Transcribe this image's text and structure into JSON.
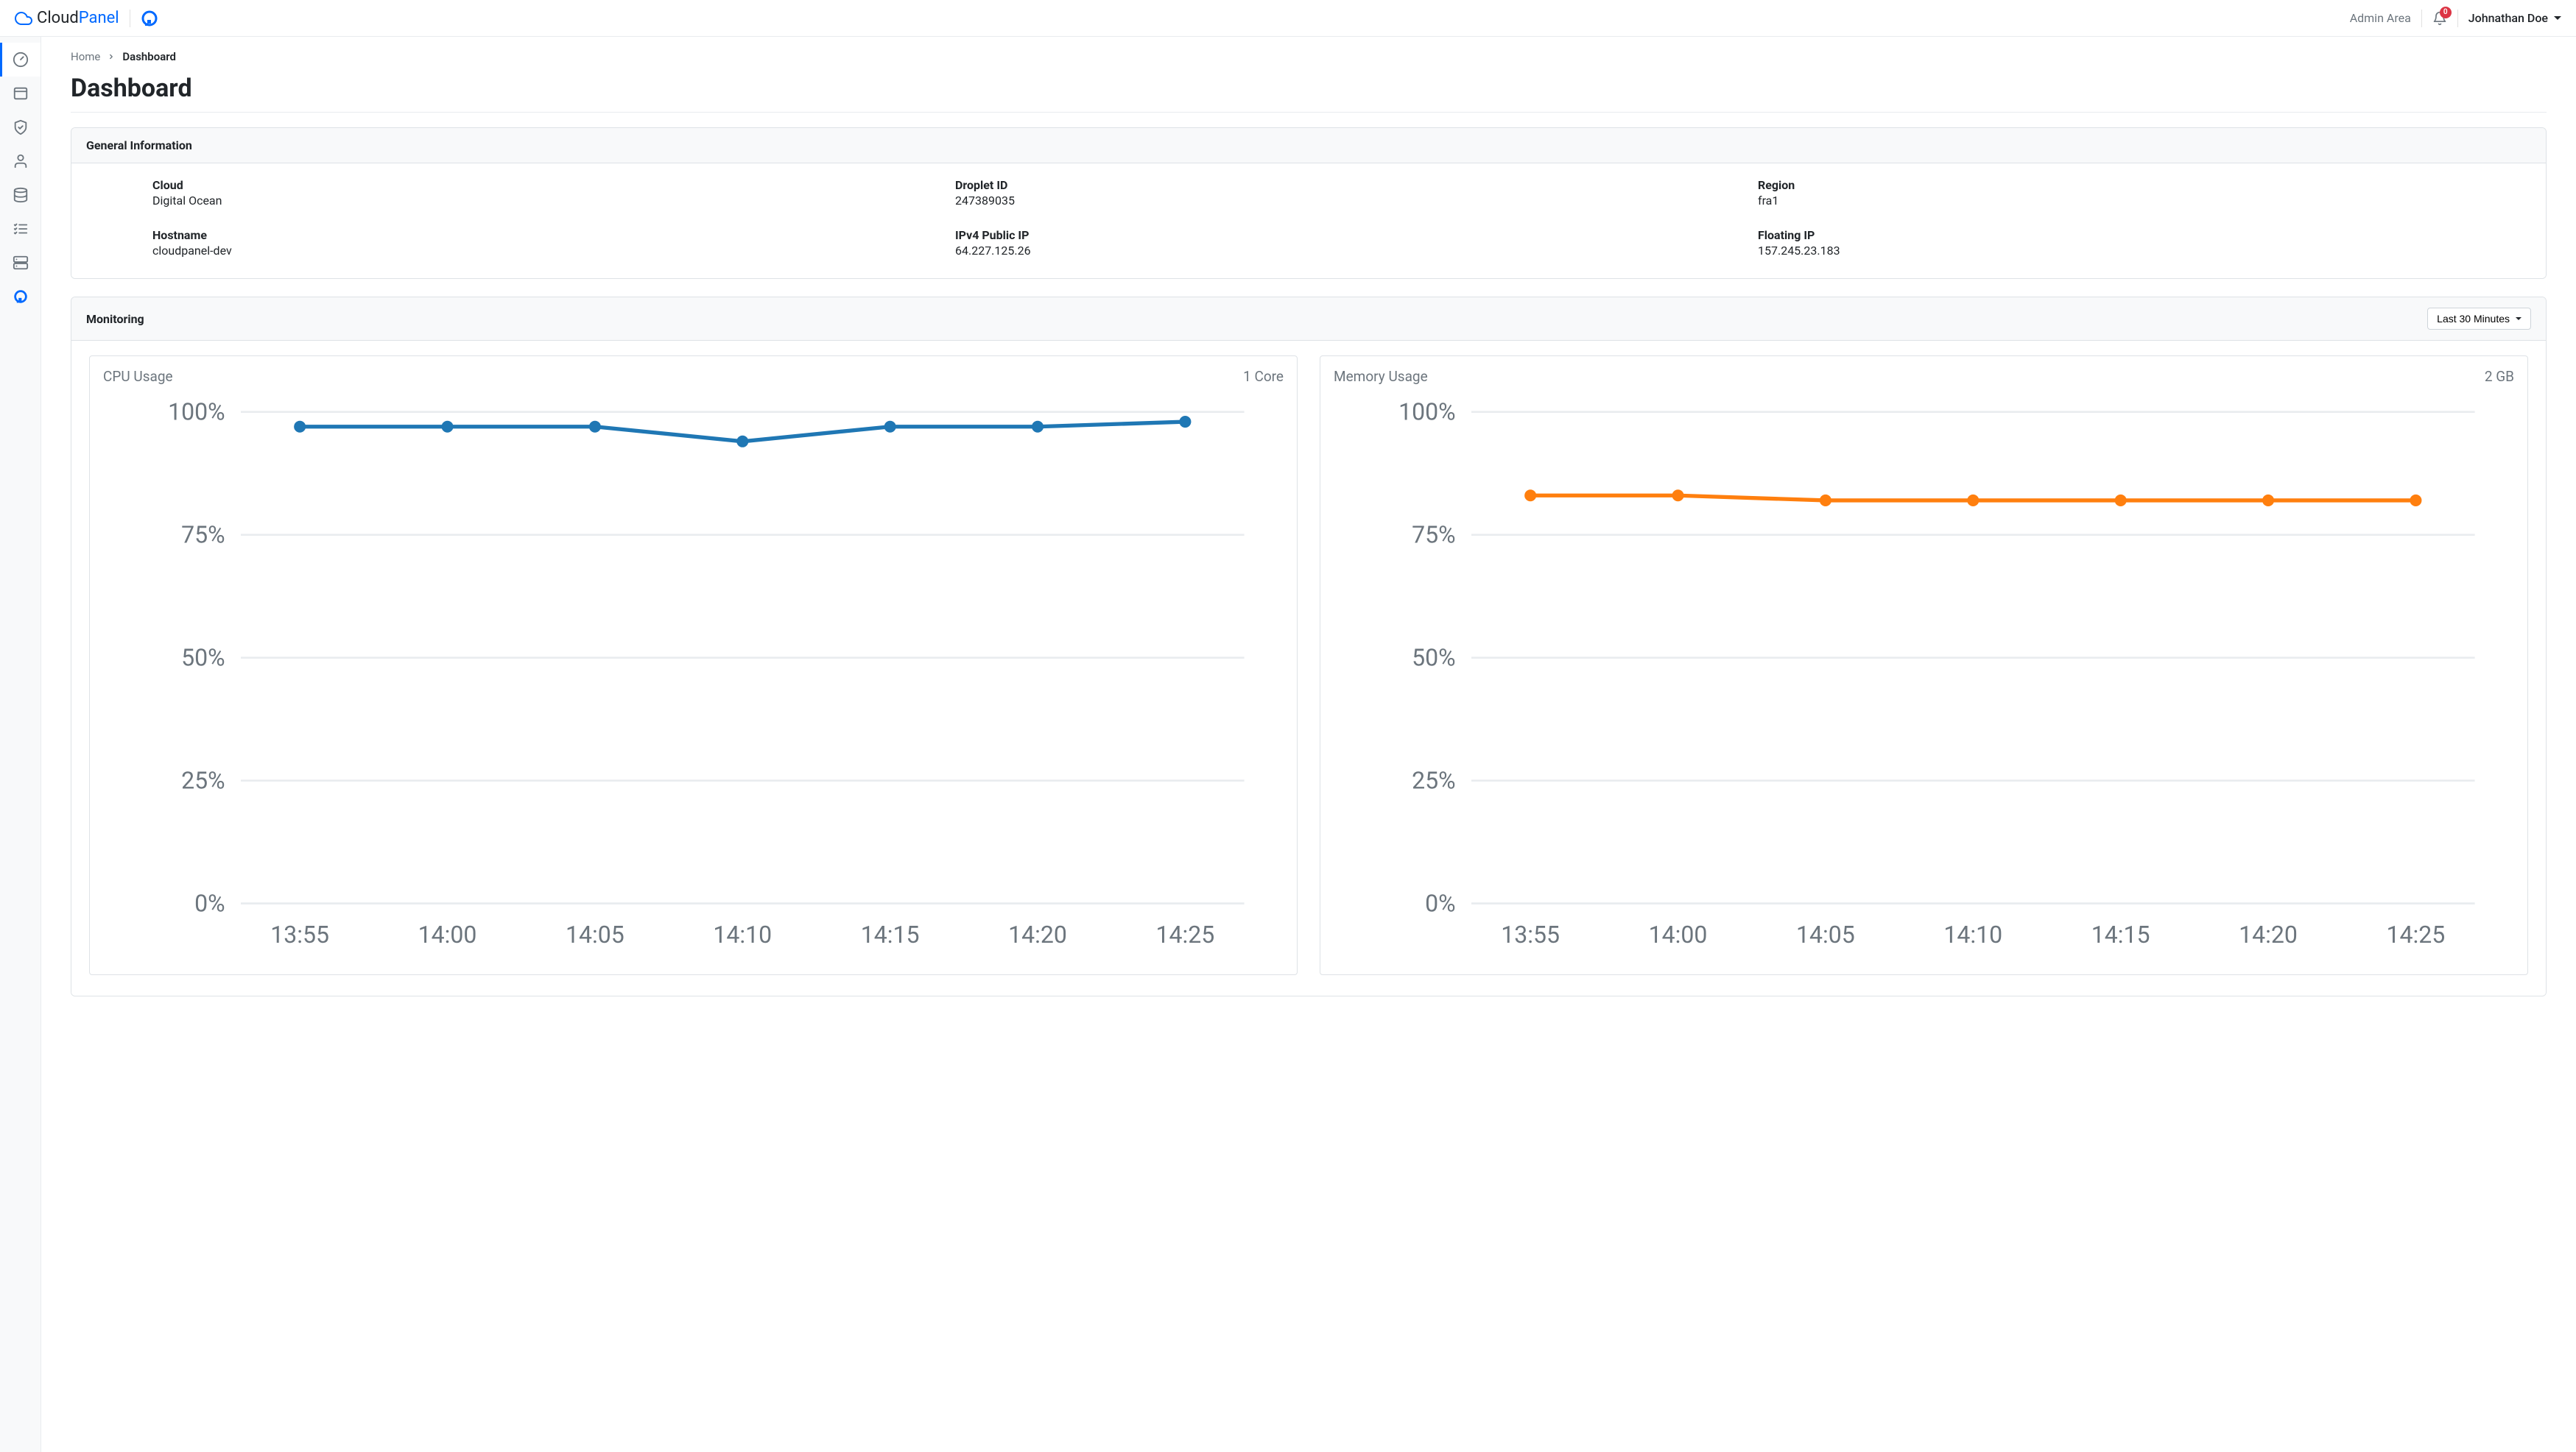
{
  "brand": {
    "part1": "Cloud",
    "part2": "Panel"
  },
  "header": {
    "admin_area": "Admin Area",
    "notifications_count": "0",
    "user_name": "Johnathan Doe"
  },
  "breadcrumb": {
    "home": "Home",
    "current": "Dashboard"
  },
  "page_title": "Dashboard",
  "general_info": {
    "title": "General Information",
    "items": [
      {
        "label": "Cloud",
        "value": "Digital Ocean"
      },
      {
        "label": "Droplet ID",
        "value": "247389035"
      },
      {
        "label": "Region",
        "value": "fra1"
      },
      {
        "label": "Hostname",
        "value": "cloudpanel-dev"
      },
      {
        "label": "IPv4 Public IP",
        "value": "64.227.125.26"
      },
      {
        "label": "Floating IP",
        "value": "157.245.23.183"
      }
    ]
  },
  "monitoring": {
    "title": "Monitoring",
    "range_selected": "Last 30 Minutes",
    "charts": {
      "cpu": {
        "title": "CPU Usage",
        "subtitle": "1 Core"
      },
      "memory": {
        "title": "Memory Usage",
        "subtitle": "2 GB"
      }
    }
  },
  "chart_data": [
    {
      "type": "line",
      "title": "CPU Usage",
      "subtitle": "1 Core",
      "xlabel": "",
      "ylabel": "",
      "categories": [
        "13:55",
        "14:00",
        "14:05",
        "14:10",
        "14:15",
        "14:20",
        "14:25"
      ],
      "series": [
        {
          "name": "CPU",
          "color": "#1f77b4",
          "values": [
            97,
            97,
            97,
            94,
            97,
            97,
            98
          ]
        }
      ],
      "ylim": [
        0,
        100
      ],
      "yticks": [
        "0%",
        "25%",
        "50%",
        "75%",
        "100%"
      ]
    },
    {
      "type": "line",
      "title": "Memory Usage",
      "subtitle": "2 GB",
      "xlabel": "",
      "ylabel": "",
      "categories": [
        "13:55",
        "14:00",
        "14:05",
        "14:10",
        "14:15",
        "14:20",
        "14:25"
      ],
      "series": [
        {
          "name": "Memory",
          "color": "#ff7f0e",
          "values": [
            83,
            83,
            82,
            82,
            82,
            82,
            82
          ]
        }
      ],
      "ylim": [
        0,
        100
      ],
      "yticks": [
        "0%",
        "25%",
        "50%",
        "75%",
        "100%"
      ]
    }
  ]
}
